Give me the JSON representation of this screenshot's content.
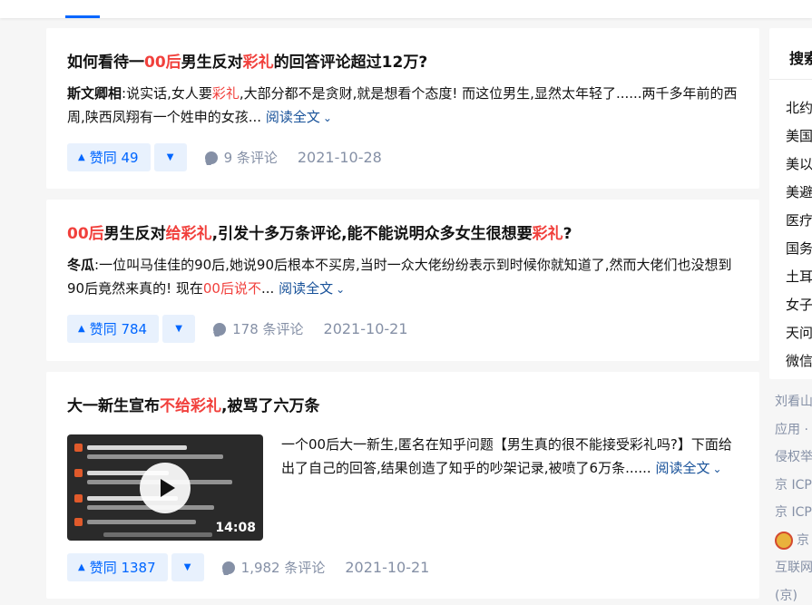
{
  "answers": [
    {
      "title_parts": [
        {
          "text": "如何看待一",
          "hl": false
        },
        {
          "text": "00后",
          "hl": true
        },
        {
          "text": "男生反对",
          "hl": false
        },
        {
          "text": "彩礼",
          "hl": true
        },
        {
          "text": "的回答评论超过12万?",
          "hl": false
        }
      ],
      "author": "斯文卿相",
      "excerpt_parts": [
        {
          "text": ":说实话,女人要",
          "hl": false
        },
        {
          "text": "彩礼",
          "hl": true
        },
        {
          "text": ",大部分都不是贪财,就是想看个态度! 而这位男生,显然太年轻了......两千多年前的西周,陕西凤翔有一个姓申的女孩...",
          "hl": false
        }
      ],
      "read_more": "阅读全文",
      "upvote_label": "赞同 49",
      "comments": "9 条评论",
      "date": "2021-10-28"
    },
    {
      "title_parts": [
        {
          "text": "00后",
          "hl": true
        },
        {
          "text": "男生反对",
          "hl": false
        },
        {
          "text": "给彩礼",
          "hl": true
        },
        {
          "text": ",引发十多万条评论,能不能说明众多女生很想要",
          "hl": false
        },
        {
          "text": "彩礼",
          "hl": true
        },
        {
          "text": "?",
          "hl": false
        }
      ],
      "author": "冬瓜",
      "excerpt_parts": [
        {
          "text": ":一位叫马佳佳的90后,她说90后根本不买房,当时一众大佬纷纷表示到时候你就知道了,然而大佬们也没想到90后竟然来真的! 现在",
          "hl": false
        },
        {
          "text": "00后说不",
          "hl": true
        },
        {
          "text": "...",
          "hl": false
        }
      ],
      "read_more": "阅读全文",
      "upvote_label": "赞同 784",
      "comments": "178 条评论",
      "date": "2021-10-21"
    },
    {
      "title_parts": [
        {
          "text": "大一新生宣布",
          "hl": false
        },
        {
          "text": "不给彩礼",
          "hl": true
        },
        {
          "text": ",被骂了六万条",
          "hl": false
        }
      ],
      "video_text": "一个00后大一新生,匿名在知乎问题【男生真的很不能接受彩礼吗?】下面给出了自己的回答,结果创造了知乎的吵架记录,被喷了6万条......",
      "video_duration": "14:08",
      "read_more": "阅读全文",
      "upvote_label": "赞同 1387",
      "comments": "1,982 条评论",
      "date": "2021-10-21"
    }
  ],
  "sidebar": {
    "heading": "搜索",
    "items": [
      "北约",
      "美国",
      "美以",
      "美避",
      "医疗",
      "国务",
      "土耳",
      "女子",
      "天问",
      "微信"
    ],
    "footer": [
      "刘看山",
      "应用 ·",
      "侵权举",
      "京 ICP",
      "京 ICP",
      "京",
      "互联网",
      "(京)"
    ]
  },
  "colors": {
    "accent": "#0066ff",
    "highlight": "#f1403c",
    "link": "#175199",
    "meta": "#8590a6"
  }
}
